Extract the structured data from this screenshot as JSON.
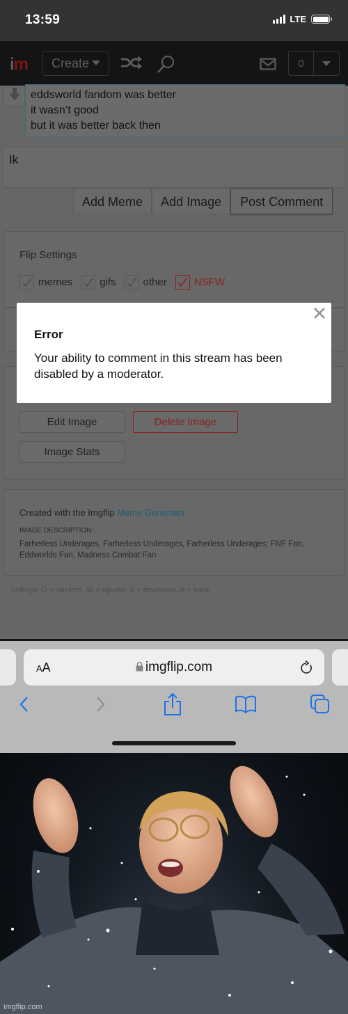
{
  "status_bar": {
    "time": "13:59",
    "network": "LTE"
  },
  "navbar": {
    "logo_i": "i",
    "logo_m": "m",
    "create_label": "Create",
    "notification_count": "0",
    "icons": [
      "shuffle-icon",
      "search-icon",
      "mail-icon",
      "chevron-down-icon"
    ]
  },
  "previous_comment": {
    "lines": [
      "eddsworld fandom was better",
      "it wasn’t good",
      "but it was better back then"
    ]
  },
  "reply": {
    "value": "Ik",
    "buttons": {
      "add_meme": "Add Meme",
      "add_image": "Add Image",
      "post_comment": "Post Comment"
    }
  },
  "flip_settings": {
    "title": "Flip Settings",
    "options": [
      {
        "label": "memes",
        "checked": true
      },
      {
        "label": "gifs",
        "checked": true
      },
      {
        "label": "other",
        "checked": true
      },
      {
        "label": "NSFW",
        "checked": true
      }
    ]
  },
  "image_actions": {
    "edit": "Edit Image",
    "delete": "Delete Image",
    "stats": "Image Stats"
  },
  "image_info": {
    "created_prefix": "Created with the Imgflip ",
    "created_link": "Meme Generator",
    "description_label": "IMAGE DESCRIPTION:",
    "description": "Farherless Underages, Farherless Underages, Farherless Underages; FNF Fan, Eddworlds Fan, Madness Combat Fan"
  },
  "hotkeys": "hotkeys: D = random, W = upvote, S = downvote, A = back",
  "modal": {
    "title": "Error",
    "message": "Your ability to comment in this stream has been disabled by a moderator."
  },
  "safari": {
    "text_size_label_small": "A",
    "text_size_label_large": "A",
    "url": "imgflip.com"
  },
  "meme_image": {
    "watermark": "imgflip.com"
  },
  "colors": {
    "accent_link": "#1f5f73",
    "danger": "#8a2020",
    "safari_blue": "#1a73e8"
  }
}
